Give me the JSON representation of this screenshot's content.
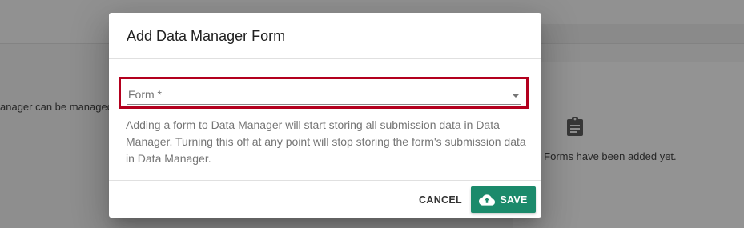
{
  "background": {
    "left_text": "anager can be managed",
    "right_text": "er Forms have been added yet.",
    "empty_icon": "clipboard-icon"
  },
  "dialog": {
    "title": "Add Data Manager Form",
    "form_field": {
      "label": "Form *",
      "value": "",
      "icon": "dropdown-arrow-icon"
    },
    "helper_text": "Adding a form to Data Manager will start storing all submission data in Data Manager. Turning this off at any point will stop storing the form's submission data in Data Manager.",
    "actions": {
      "cancel_label": "CANCEL",
      "save_label": "SAVE",
      "save_icon": "cloud-upload-icon"
    }
  },
  "colors": {
    "primary": "#1b8a6b",
    "highlight": "#b3001e"
  }
}
